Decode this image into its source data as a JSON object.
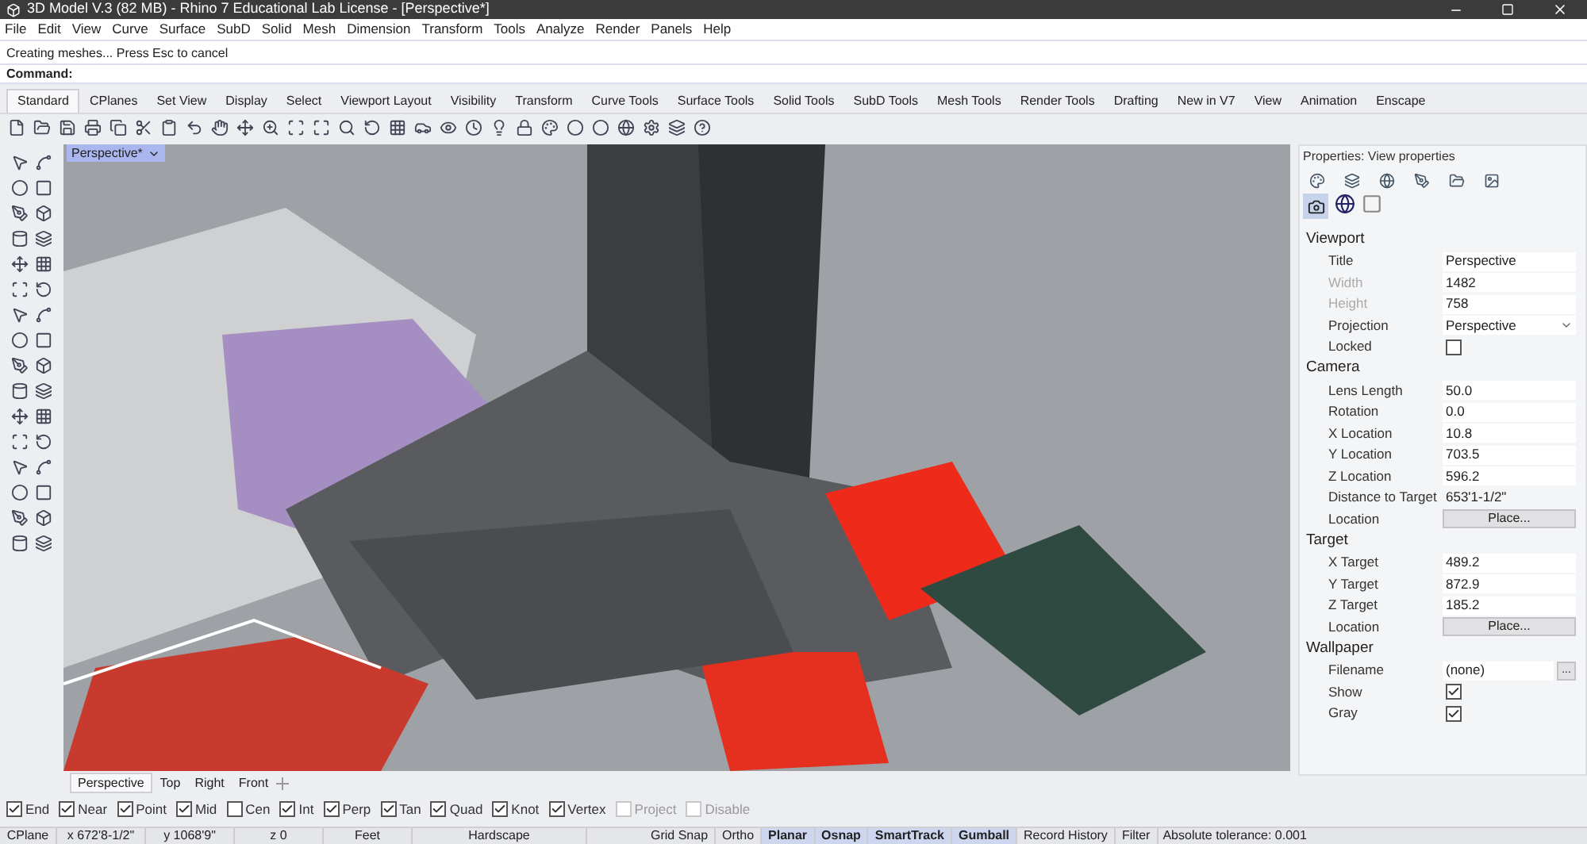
{
  "window": {
    "title": "3D Model V.3 (82 MB) - Rhino 7 Educational Lab License - [Perspective*]"
  },
  "menu": [
    "File",
    "Edit",
    "View",
    "Curve",
    "Surface",
    "SubD",
    "Solid",
    "Mesh",
    "Dimension",
    "Transform",
    "Tools",
    "Analyze",
    "Render",
    "Panels",
    "Help"
  ],
  "command_history": "Creating meshes... Press Esc to cancel",
  "command": {
    "label": "Command:"
  },
  "toolbar_tabs": [
    {
      "label": "Standard",
      "selected": true
    },
    {
      "label": "CPlanes",
      "selected": false
    },
    {
      "label": "Set View",
      "selected": false
    },
    {
      "label": "Display",
      "selected": false
    },
    {
      "label": "Select",
      "selected": false
    },
    {
      "label": "Viewport Layout",
      "selected": false
    },
    {
      "label": "Visibility",
      "selected": false
    },
    {
      "label": "Transform",
      "selected": false
    },
    {
      "label": "Curve Tools",
      "selected": false
    },
    {
      "label": "Surface Tools",
      "selected": false
    },
    {
      "label": "Solid Tools",
      "selected": false
    },
    {
      "label": "SubD Tools",
      "selected": false
    },
    {
      "label": "Mesh Tools",
      "selected": false
    },
    {
      "label": "Render Tools",
      "selected": false
    },
    {
      "label": "Drafting",
      "selected": false
    },
    {
      "label": "New in V7",
      "selected": false
    },
    {
      "label": "View",
      "selected": false
    },
    {
      "label": "Animation",
      "selected": false
    },
    {
      "label": "Enscape",
      "selected": false
    }
  ],
  "viewport": {
    "title": "Perspective*"
  },
  "viewport_tabs": [
    {
      "label": "Perspective",
      "selected": true
    },
    {
      "label": "Top",
      "selected": false
    },
    {
      "label": "Right",
      "selected": false
    },
    {
      "label": "Front",
      "selected": false
    }
  ],
  "properties": {
    "title": "Properties: View properties",
    "sections": [
      {
        "title": "Viewport",
        "rows": [
          {
            "kind": "text",
            "label": "Title",
            "value": "Perspective",
            "disabled": false
          },
          {
            "kind": "text",
            "label": "Width",
            "value": "1482",
            "disabled": true
          },
          {
            "kind": "text",
            "label": "Height",
            "value": "758",
            "disabled": true
          },
          {
            "kind": "dropdown",
            "label": "Projection",
            "value": "Perspective",
            "disabled": false
          },
          {
            "kind": "checkbox",
            "label": "Locked",
            "checked": false,
            "disabled": false
          }
        ]
      },
      {
        "title": "Camera",
        "rows": [
          {
            "kind": "text",
            "label": "Lens Length",
            "value": "50.0",
            "disabled": false
          },
          {
            "kind": "text",
            "label": "Rotation",
            "value": "0.0",
            "disabled": false
          },
          {
            "kind": "text",
            "label": "X Location",
            "value": "10.8",
            "disabled": false
          },
          {
            "kind": "text",
            "label": "Y Location",
            "value": "703.5",
            "disabled": false
          },
          {
            "kind": "text",
            "label": "Z Location",
            "value": "596.2",
            "disabled": false
          },
          {
            "kind": "readonly",
            "label": "Distance to Target",
            "value": "653'1-1/2\"",
            "disabled": false
          },
          {
            "kind": "button",
            "label": "Location",
            "value": "Place...",
            "disabled": false
          }
        ]
      },
      {
        "title": "Target",
        "rows": [
          {
            "kind": "text",
            "label": "X Target",
            "value": "489.2",
            "disabled": false
          },
          {
            "kind": "text",
            "label": "Y Target",
            "value": "872.9",
            "disabled": false
          },
          {
            "kind": "text",
            "label": "Z Target",
            "value": "185.2",
            "disabled": false
          },
          {
            "kind": "button",
            "label": "Location",
            "value": "Place...",
            "disabled": false
          }
        ]
      },
      {
        "title": "Wallpaper",
        "rows": [
          {
            "kind": "file",
            "label": "Filename",
            "value": "(none)",
            "button": "...",
            "disabled": false
          },
          {
            "kind": "checkbox",
            "label": "Show",
            "checked": true,
            "disabled": false
          },
          {
            "kind": "checkbox",
            "label": "Gray",
            "checked": true,
            "disabled": false
          }
        ]
      }
    ]
  },
  "osnaps": [
    {
      "label": "End",
      "checked": true,
      "disabled": false
    },
    {
      "label": "Near",
      "checked": true,
      "disabled": false
    },
    {
      "label": "Point",
      "checked": true,
      "disabled": false
    },
    {
      "label": "Mid",
      "checked": true,
      "disabled": false
    },
    {
      "label": "Cen",
      "checked": false,
      "disabled": false
    },
    {
      "label": "Int",
      "checked": true,
      "disabled": false
    },
    {
      "label": "Perp",
      "checked": true,
      "disabled": false
    },
    {
      "label": "Tan",
      "checked": true,
      "disabled": false
    },
    {
      "label": "Quad",
      "checked": true,
      "disabled": false
    },
    {
      "label": "Knot",
      "checked": true,
      "disabled": false
    },
    {
      "label": "Vertex",
      "checked": true,
      "disabled": false
    },
    {
      "label": "Project",
      "checked": false,
      "disabled": true
    },
    {
      "label": "Disable",
      "checked": false,
      "disabled": true
    }
  ],
  "status_bar": {
    "fields": [
      "CPlane",
      "x 672'8-1/2\"",
      "y 1068'9\"",
      "z 0",
      "Feet",
      "Hardscape"
    ],
    "toggles": [
      {
        "label": "Grid Snap",
        "on": false
      },
      {
        "label": "Ortho",
        "on": false
      },
      {
        "label": "Planar",
        "on": true
      },
      {
        "label": "Osnap",
        "on": true
      },
      {
        "label": "SmartTrack",
        "on": true
      },
      {
        "label": "Gumball",
        "on": true
      },
      {
        "label": "Record History",
        "on": false
      },
      {
        "label": "Filter",
        "on": false
      }
    ],
    "tolerance": "Absolute tolerance: 0.001"
  }
}
